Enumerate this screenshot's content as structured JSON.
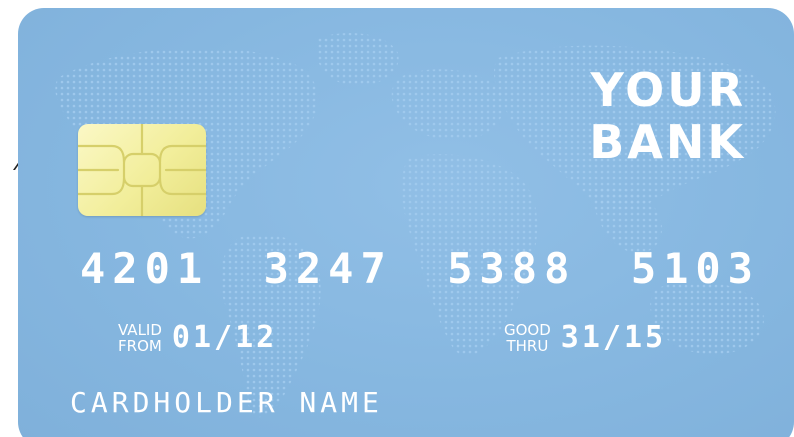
{
  "card": {
    "bank_name_line1": "YOUR",
    "bank_name_line2": "BANK",
    "number_groups": [
      "4201",
      "3247",
      "5388",
      "5103"
    ],
    "valid_from": {
      "label_top": "VALID",
      "label_bottom": "FROM",
      "value": "01/12"
    },
    "good_thru": {
      "label_top": "GOOD",
      "label_bottom": "THRU",
      "value": "31/15"
    },
    "cardholder_name": "CARDHOLDER NAME"
  },
  "colors": {
    "card_background": "#88b8e0",
    "map_dots": "#9bc7ec",
    "chip": "#f4f0a8",
    "text": "#ffffff"
  }
}
